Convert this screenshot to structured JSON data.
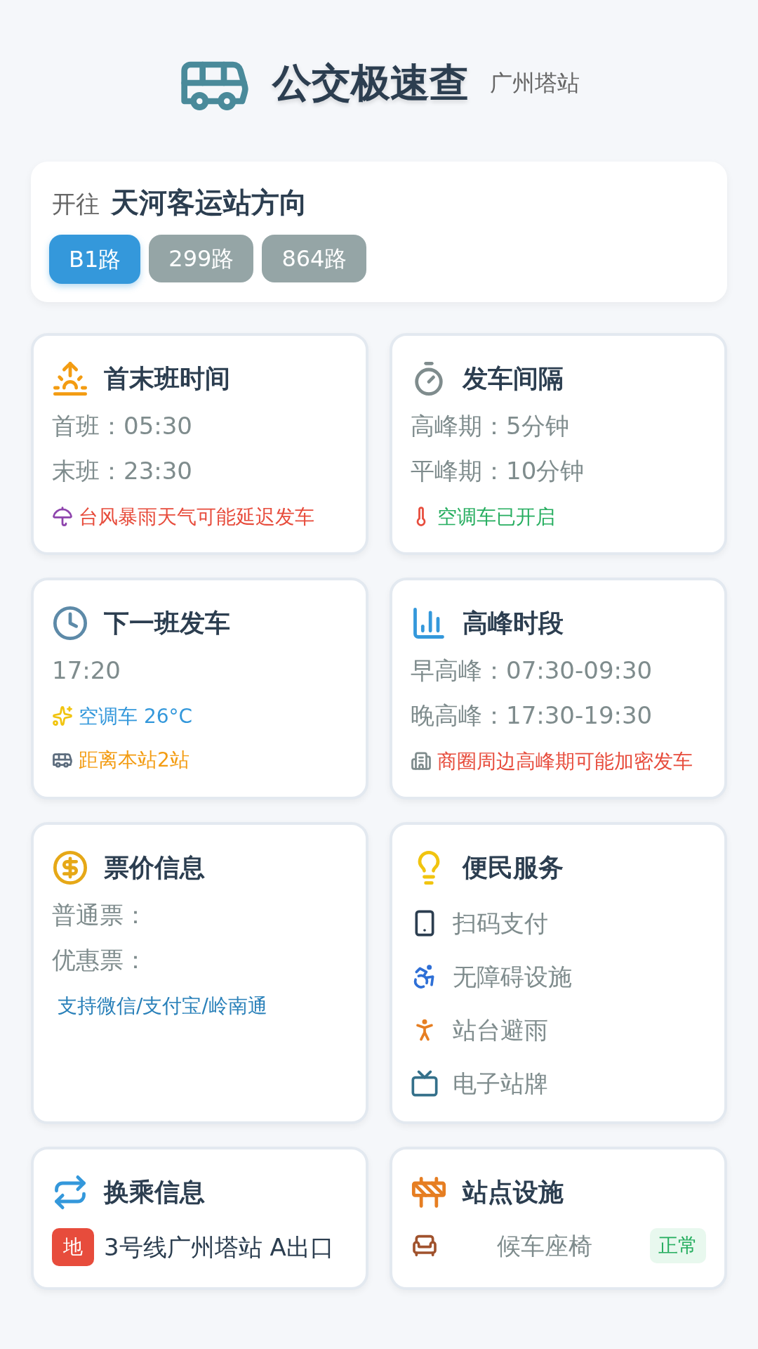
{
  "header": {
    "title": "公交极速查",
    "station": "广州塔站"
  },
  "direction": {
    "prefix": "开往",
    "destination": "天河客运站方向",
    "routes": [
      {
        "label": "B1路",
        "selected": true
      },
      {
        "label": "299路",
        "selected": false
      },
      {
        "label": "864路",
        "selected": false
      }
    ]
  },
  "cards": [
    {
      "kind": "info",
      "title": "首末班时间",
      "lines": [
        "首班：05:30",
        "末班：23:30"
      ],
      "notes": [
        {
          "text": "台风暴雨天气可能延迟发车",
          "color": "#e74c3c"
        }
      ]
    },
    {
      "kind": "info",
      "title": "发车间隔",
      "lines": [
        "高峰期：5分钟",
        "平峰期：10分钟"
      ],
      "notes": [
        {
          "text": "空调车已开启",
          "color": "#27ae60"
        }
      ]
    },
    {
      "kind": "info",
      "title": "下一班发车",
      "lines": [
        "17:20"
      ],
      "notes": [
        {
          "text": "空调车 26°C",
          "color": "#3498db"
        },
        {
          "text": "距离本站2站",
          "color": "#f39c12"
        }
      ]
    },
    {
      "kind": "info",
      "title": "高峰时段",
      "lines": [
        "早高峰：07:30-09:30",
        "晚高峰：17:30-19:30"
      ],
      "notes": [
        {
          "text": "商圈周边高峰期可能加密发车",
          "color": "#e74c3c"
        }
      ]
    },
    {
      "kind": "info",
      "title": "票价信息",
      "lines": [
        "普通票：",
        "优惠票："
      ],
      "notes": [
        {
          "text": "支持微信/支付宝/岭南通",
          "color": "#2980b9"
        }
      ]
    },
    {
      "kind": "services",
      "title": "便民服务",
      "items": [
        "扫码支付",
        "无障碍设施",
        "站台避雨",
        "电子站牌"
      ]
    },
    {
      "kind": "transfers",
      "title": "换乘信息",
      "items": [
        {
          "badge": "地",
          "text": "3号线广州塔站 A出口"
        }
      ]
    },
    {
      "kind": "facilities",
      "title": "站点设施",
      "items": [
        {
          "name": "候车座椅",
          "status": "正常"
        }
      ]
    }
  ]
}
